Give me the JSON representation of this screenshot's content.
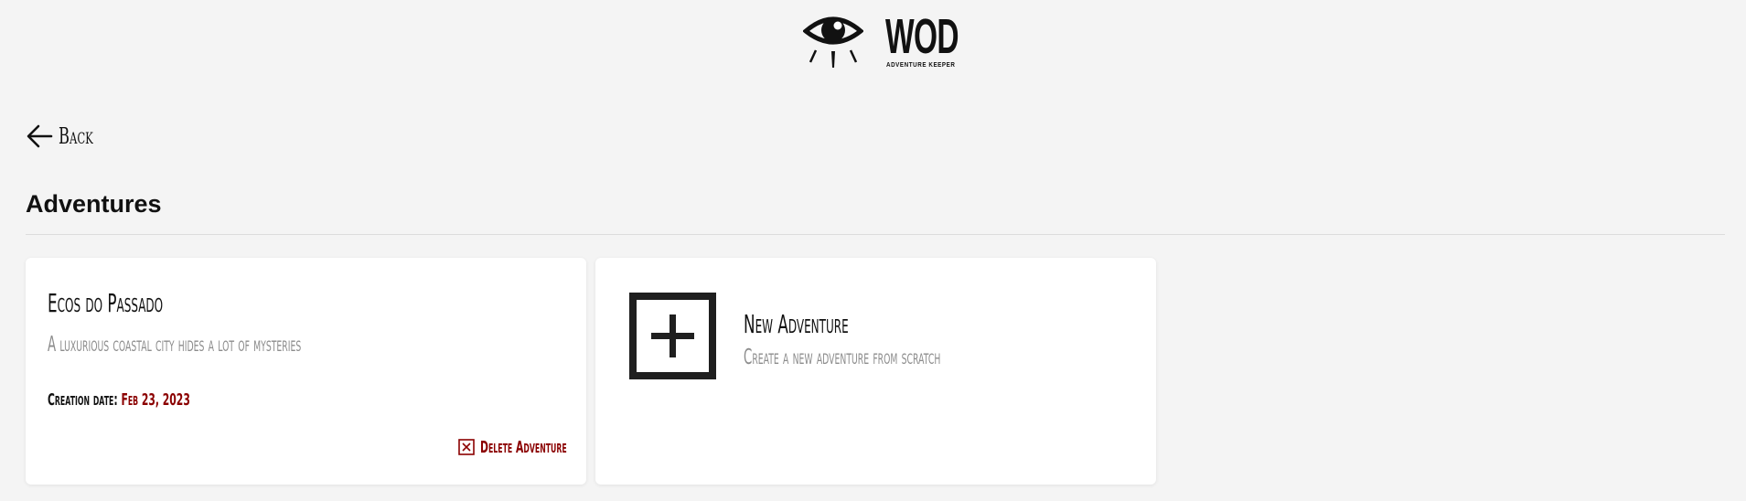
{
  "header": {
    "logo_title": "WOD",
    "logo_subtitle": "ADVENTURE KEEPER",
    "logo_icon": "eye-icon"
  },
  "nav": {
    "back_label": "Back",
    "back_icon": "arrow-left-icon"
  },
  "main": {
    "title": "Adventures",
    "adventures": [
      {
        "name": "Ecos do Passado",
        "description": "A luxurious coastal city hides a lot of mysteries",
        "creation_label": "Creation date:",
        "creation_date": "Feb 23, 2023",
        "delete_label": "Delete Adventure",
        "delete_icon": "close-box-icon"
      }
    ],
    "new_adventure": {
      "title": "New Adventure",
      "description": "Create a new adventure from scratch",
      "icon": "plus-box-icon"
    }
  },
  "colors": {
    "background": "#f4f4f4",
    "card": "#ffffff",
    "accent": "#8b0000",
    "muted_text": "#8c8c8c"
  }
}
